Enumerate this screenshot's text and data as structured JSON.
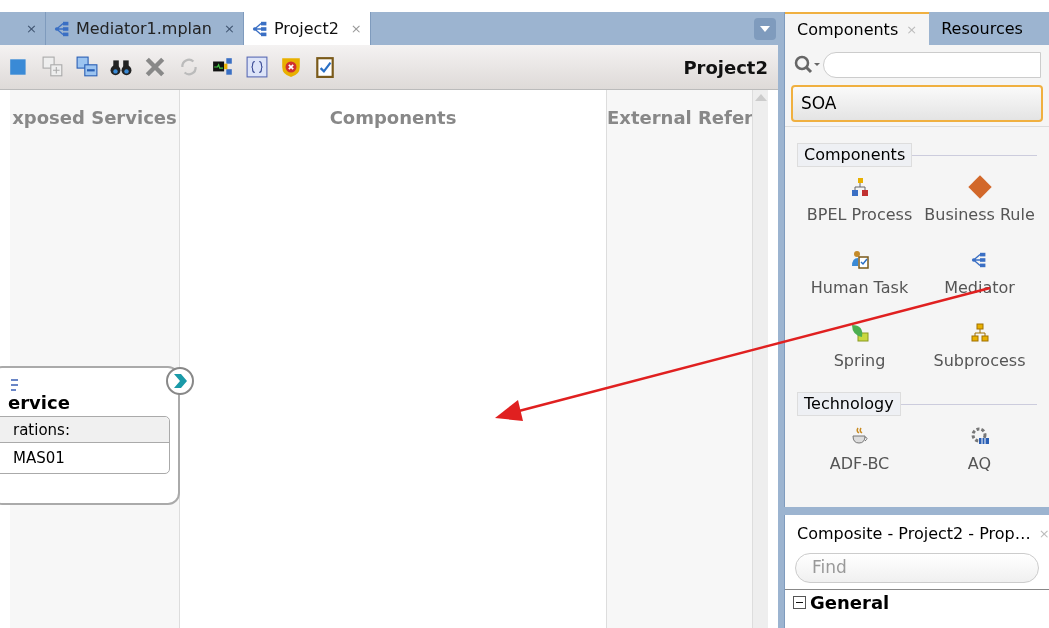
{
  "editor": {
    "tabs": [
      {
        "close": "×",
        "selected": false
      },
      {
        "label": "Mediator1.mplan",
        "close": "×",
        "selected": false
      },
      {
        "label": "Project2",
        "close": "×",
        "selected": true
      }
    ],
    "title": "Project2",
    "lanes": [
      "xposed Services",
      "Components",
      "External Refer"
    ],
    "service_card": {
      "title": "ervice",
      "operations_header": "rations:",
      "operations": [
        "MAS01"
      ]
    }
  },
  "palette": {
    "tabs": [
      {
        "label": "Components",
        "close": "×",
        "selected": true
      },
      {
        "label": "Resources",
        "selected": false
      }
    ],
    "category": "SOA",
    "sections": [
      {
        "title": "Components",
        "items": [
          {
            "label": "BPEL Process"
          },
          {
            "label": "Business Rule"
          },
          {
            "label": "Human Task"
          },
          {
            "label": "Mediator"
          },
          {
            "label": "Spring"
          },
          {
            "label": "Subprocess"
          }
        ]
      },
      {
        "title": "Technology",
        "items": [
          {
            "label": "ADF-BC"
          },
          {
            "label": "AQ"
          }
        ]
      }
    ]
  },
  "properties": {
    "title": "Composite - Project2 - Prop…",
    "close": "×",
    "find_placeholder": "Find",
    "groups": [
      {
        "label": "General",
        "expanded": true
      }
    ]
  }
}
